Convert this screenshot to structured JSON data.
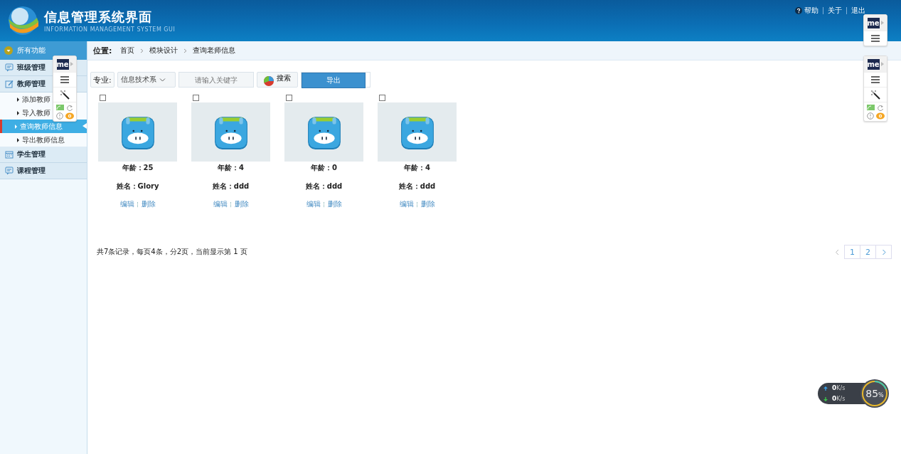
{
  "header": {
    "title": "信息管理系统界面",
    "subtitle": "INFORMATION MANAGEMENT SYSTEM GUI",
    "links": [
      "帮助",
      "关于",
      "退出"
    ]
  },
  "sidebar": {
    "heading": "所有功能",
    "groups": [
      {
        "label": "班级管理"
      },
      {
        "label": "教师管理",
        "children": [
          {
            "label": "添加教师",
            "selected": false
          },
          {
            "label": "导入教师",
            "selected": false
          },
          {
            "label": "查询教师信息",
            "selected": true
          },
          {
            "label": "导出教师信息",
            "selected": false
          }
        ]
      },
      {
        "label": "学生管理"
      },
      {
        "label": "课程管理"
      }
    ]
  },
  "breadcrumb": {
    "label": "位置:",
    "items": [
      "首页",
      "模块设计",
      "查询老师信息"
    ]
  },
  "filter": {
    "label": "专业:",
    "select": "信息技术系",
    "placeholder": "请输入关键字",
    "search": "搜索",
    "export": "导出"
  },
  "cards": [
    {
      "checked": false,
      "age": "年龄：25",
      "name": "姓名：Glory",
      "actions": [
        "编辑",
        "删除"
      ]
    },
    {
      "checked": false,
      "age": "年龄：4",
      "name": "姓名：ddd",
      "actions": [
        "编辑",
        "删除"
      ]
    },
    {
      "checked": false,
      "age": "年龄：0",
      "name": "姓名：ddd",
      "actions": [
        "编辑",
        "删除"
      ]
    },
    {
      "checked": false,
      "age": "年龄：4",
      "name": "姓名：ddd",
      "actions": [
        "编辑",
        "删除"
      ]
    }
  ],
  "pagination": {
    "summary": "共7条记录，每页4条，分2页，当前显示第 1 页",
    "prev_disabled": true,
    "pages": [
      "1",
      "2"
    ]
  },
  "overlay_toolbars": [
    {
      "logo": "me",
      "expanded": true
    },
    {
      "logo": "me",
      "expanded": false
    },
    {
      "logo": "me",
      "expanded": true
    }
  ],
  "speed_widget": {
    "up": "0",
    "up_unit": "K/s",
    "down": "0",
    "down_unit": "K/s",
    "percent": "85",
    "percent_unit": "%"
  }
}
